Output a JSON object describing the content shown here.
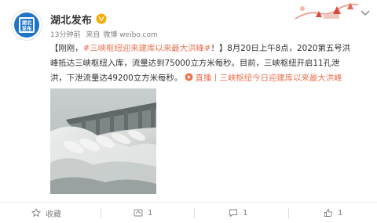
{
  "post": {
    "user_name": "湖北发布",
    "avatar_text": [
      "湖北",
      "发布"
    ],
    "time": "13分钟前",
    "source_prefix": "来自",
    "source_name": "微博 weibo.com",
    "text_open": "【刚刚，",
    "hashtag": "#三峡枢纽迎来建库以来最大洪峰#",
    "text_line1_rest": "！】8月20日上午8点，2020第五号洪",
    "text_line2": "峰抵达三峡枢纽入库，流量达到75000立方米每秒。目前，三峡枢纽开启11孔泄",
    "text_line3": "洪，下泄流量达49200立方米每秒。",
    "live_link": "直播丨三峡枢纽今日迎建库以来最大洪峰"
  },
  "actions": {
    "favorite_label": "收藏",
    "repost_count": "1",
    "comment_count": "1",
    "like_count": "1"
  },
  "colors": {
    "link": "#eb7350",
    "text": "#333333",
    "meta": "#808080",
    "avatar_bg": "#1e73c8",
    "verified": "#f6ab00"
  },
  "icons": {
    "verified": "verified-v-icon",
    "chevron": "chevron-down-icon",
    "live": "live-link-icon",
    "favorite": "star-icon",
    "repost": "repost-icon",
    "comment": "comment-icon",
    "like": "thumbs-up-icon"
  }
}
